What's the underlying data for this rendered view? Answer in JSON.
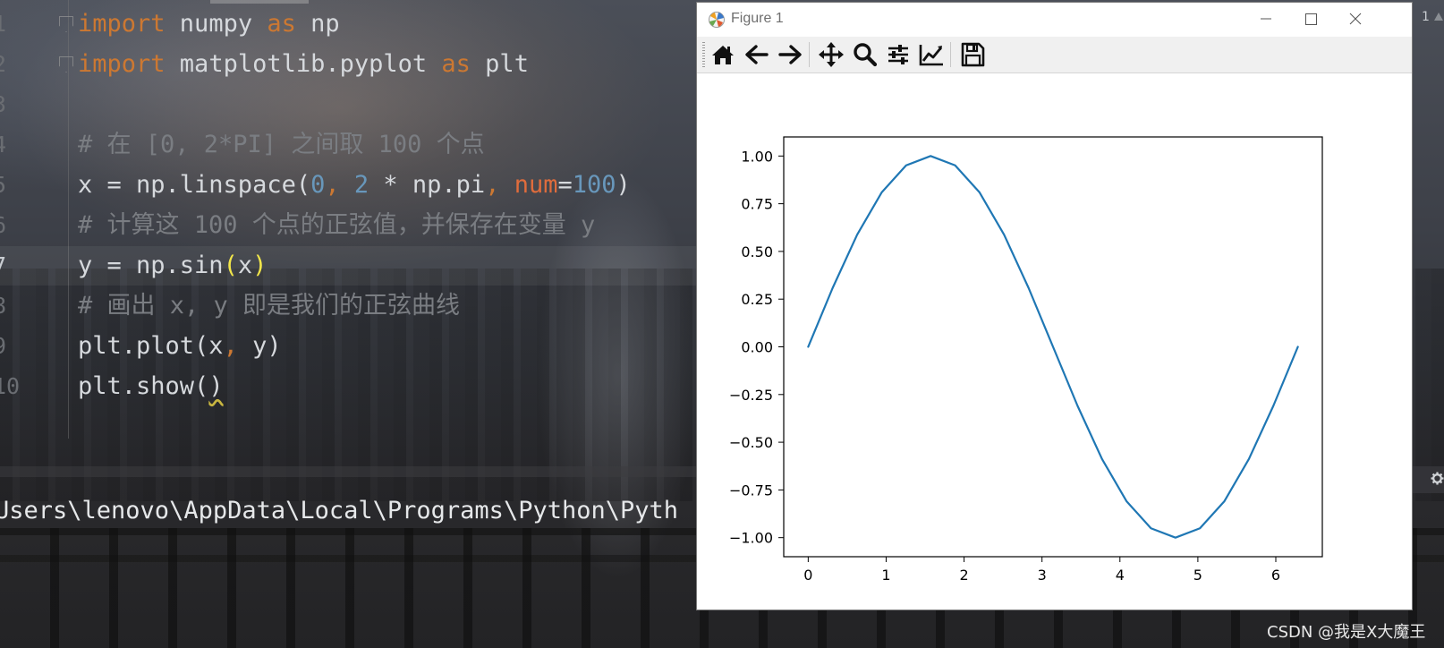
{
  "editor": {
    "lines": [
      {
        "num": "1",
        "current": false,
        "fold": true,
        "tokens": [
          {
            "t": "import",
            "c": "kw"
          },
          {
            "t": " numpy ",
            "c": ""
          },
          {
            "t": "as",
            "c": "kw"
          },
          {
            "t": " np",
            "c": ""
          }
        ]
      },
      {
        "num": "2",
        "current": false,
        "fold": true,
        "tokens": [
          {
            "t": "import",
            "c": "kw"
          },
          {
            "t": " matplotlib.pyplot ",
            "c": ""
          },
          {
            "t": "as",
            "c": "kw"
          },
          {
            "t": " plt",
            "c": ""
          }
        ]
      },
      {
        "num": "3",
        "current": false,
        "fold": false,
        "tokens": []
      },
      {
        "num": "4",
        "current": false,
        "fold": false,
        "tokens": [
          {
            "t": "# 在 [0, 2*PI] 之间取 100 个点",
            "c": "comment"
          }
        ]
      },
      {
        "num": "5",
        "current": false,
        "fold": false,
        "tokens": [
          {
            "t": "x = np.linspace(",
            "c": ""
          },
          {
            "t": "0",
            "c": "num"
          },
          {
            "t": ", ",
            "c": "kw"
          },
          {
            "t": "2",
            "c": "num"
          },
          {
            "t": " * np.pi",
            "c": ""
          },
          {
            "t": ", ",
            "c": "kw"
          },
          {
            "t": "num",
            "c": "param"
          },
          {
            "t": "=",
            "c": ""
          },
          {
            "t": "100",
            "c": "num"
          },
          {
            "t": ")",
            "c": ""
          }
        ]
      },
      {
        "num": "6",
        "current": false,
        "fold": false,
        "tokens": [
          {
            "t": "# 计算这 100 个点的正弦值，并保存在变量 y",
            "c": "comment"
          }
        ]
      },
      {
        "num": "7",
        "current": true,
        "fold": false,
        "tokens": [
          {
            "t": "y = np.sin",
            "c": ""
          },
          {
            "t": "(",
            "c": "brace"
          },
          {
            "t": "x",
            "c": ""
          },
          {
            "t": ")",
            "c": "brace"
          }
        ]
      },
      {
        "num": "8",
        "current": false,
        "fold": false,
        "tokens": [
          {
            "t": "# 画出 x, y 即是我们的正弦曲线",
            "c": "comment"
          }
        ]
      },
      {
        "num": "9",
        "current": false,
        "fold": false,
        "tokens": [
          {
            "t": "plt.plot(x",
            "c": ""
          },
          {
            "t": ", ",
            "c": "kw"
          },
          {
            "t": "y)",
            "c": ""
          }
        ]
      },
      {
        "num": "10",
        "current": false,
        "fold": false,
        "tokens": [
          {
            "t": "plt.show(",
            "c": ""
          },
          {
            "t": ")",
            "c": "squiggle"
          }
        ]
      }
    ]
  },
  "terminal": {
    "path_text": "Users\\lenovo\\AppData\\Local\\Programs\\Python\\Pyth"
  },
  "edge": {
    "count": "1"
  },
  "figure_window": {
    "title": "Figure 1",
    "toolbar": [
      {
        "name": "home-icon"
      },
      {
        "name": "back-arrow-icon"
      },
      {
        "name": "forward-arrow-icon"
      },
      {
        "name": "pan-icon"
      },
      {
        "name": "zoom-icon"
      },
      {
        "name": "subplots-config-icon"
      },
      {
        "name": "edit-axis-icon"
      },
      {
        "name": "save-icon"
      }
    ],
    "line_color": "#1f77b4"
  },
  "chart_data": {
    "type": "line",
    "title": "",
    "xlabel": "",
    "ylabel": "",
    "xlim": [
      -0.314,
      6.597
    ],
    "ylim": [
      -1.1,
      1.1
    ],
    "xticks": [
      0,
      1,
      2,
      3,
      4,
      5,
      6
    ],
    "xtick_labels": [
      "0",
      "1",
      "2",
      "3",
      "4",
      "5",
      "6"
    ],
    "yticks": [
      -1.0,
      -0.75,
      -0.5,
      -0.25,
      0.0,
      0.25,
      0.5,
      0.75,
      1.0
    ],
    "ytick_labels": [
      "−1.00",
      "−0.75",
      "−0.50",
      "−0.25",
      "0.00",
      "0.25",
      "0.50",
      "0.75",
      "1.00"
    ],
    "grid": false,
    "series": [
      {
        "color": "#1f77b4",
        "x": [
          0,
          0.3142,
          0.6283,
          0.9425,
          1.2566,
          1.5708,
          1.885,
          2.1991,
          2.5133,
          2.8274,
          3.1416,
          3.4558,
          3.7699,
          4.0841,
          4.3982,
          4.7124,
          5.0265,
          5.3407,
          5.6549,
          5.969,
          6.2832
        ],
        "y": [
          0,
          0.309,
          0.5878,
          0.809,
          0.9511,
          1.0,
          0.9511,
          0.809,
          0.5878,
          0.309,
          0,
          -0.309,
          -0.5878,
          -0.809,
          -0.9511,
          -1.0,
          -0.9511,
          -0.809,
          -0.5878,
          -0.309,
          0
        ]
      }
    ]
  },
  "watermark": "CSDN @我是X大魔王"
}
